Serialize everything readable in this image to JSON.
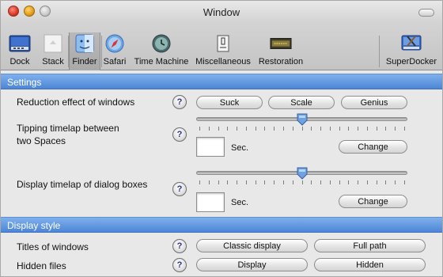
{
  "window": {
    "title": "Window"
  },
  "toolbar": {
    "items": [
      {
        "label": "Dock",
        "icon": "dock-icon"
      },
      {
        "label": "Stack",
        "icon": "stack-icon"
      },
      {
        "label": "Finder",
        "icon": "finder-icon",
        "selected": true
      },
      {
        "label": "Safari",
        "icon": "safari-icon"
      },
      {
        "label": "Time Machine",
        "icon": "time-machine-icon"
      },
      {
        "label": "Miscellaneous",
        "icon": "miscellaneous-icon"
      },
      {
        "label": "Restoration",
        "icon": "restoration-icon"
      },
      {
        "label": "SuperDocker",
        "icon": "superdocker-icon"
      }
    ]
  },
  "settings": {
    "header": "Settings",
    "reduction": {
      "label": "Reduction effect of windows",
      "help": "?",
      "options": [
        "Suck",
        "Scale",
        "Genius"
      ]
    },
    "tipping": {
      "label_line1": "Tipping timelap between",
      "label_line2": "two Spaces",
      "help": "?",
      "unit": "Sec.",
      "value": "",
      "button": "Change",
      "slider_level": 0.5
    },
    "dialog": {
      "label": "Display timelap of dialog boxes",
      "help": "?",
      "unit": "Sec.",
      "value": "",
      "button": "Change",
      "slider_level": 0.5
    }
  },
  "display_style": {
    "header": "Display style",
    "titles": {
      "label": "Titles of windows",
      "help": "?",
      "options": [
        "Classic display",
        "Full path"
      ]
    },
    "hidden": {
      "label": "Hidden files",
      "help": "?",
      "options": [
        "Display",
        "Hidden"
      ]
    }
  },
  "colors": {
    "section_header": "#5a91dc",
    "title_close": "#d7382a",
    "title_minimize": "#e49a16"
  }
}
